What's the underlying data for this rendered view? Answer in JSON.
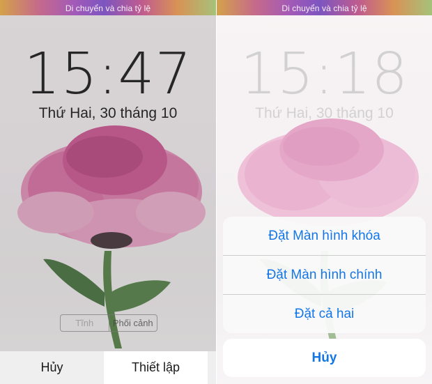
{
  "left_panel": {
    "banner": "Di chuyển và chia tỷ lệ",
    "time": "15:47",
    "date": "Thứ Hai, 30 tháng 10",
    "mode_segments": {
      "still": "Tĩnh",
      "perspective": "Phối cảnh"
    },
    "bottom_bar": {
      "cancel": "Hủy",
      "set": "Thiết lập"
    }
  },
  "right_panel": {
    "banner": "Di chuyển và chia tỷ lệ",
    "time": "15:18",
    "date": "Thứ Hai, 30 tháng 10",
    "action_sheet": {
      "items": [
        {
          "label": "Đặt Màn hình khóa"
        },
        {
          "label": "Đặt Màn hình chính"
        },
        {
          "label": "Đặt cả hai"
        }
      ],
      "cancel": "Hủy"
    }
  },
  "colors": {
    "accent_blue": "#1476e6",
    "flower_pink": "#d45a96",
    "leaf_green": "#3f6b35"
  }
}
